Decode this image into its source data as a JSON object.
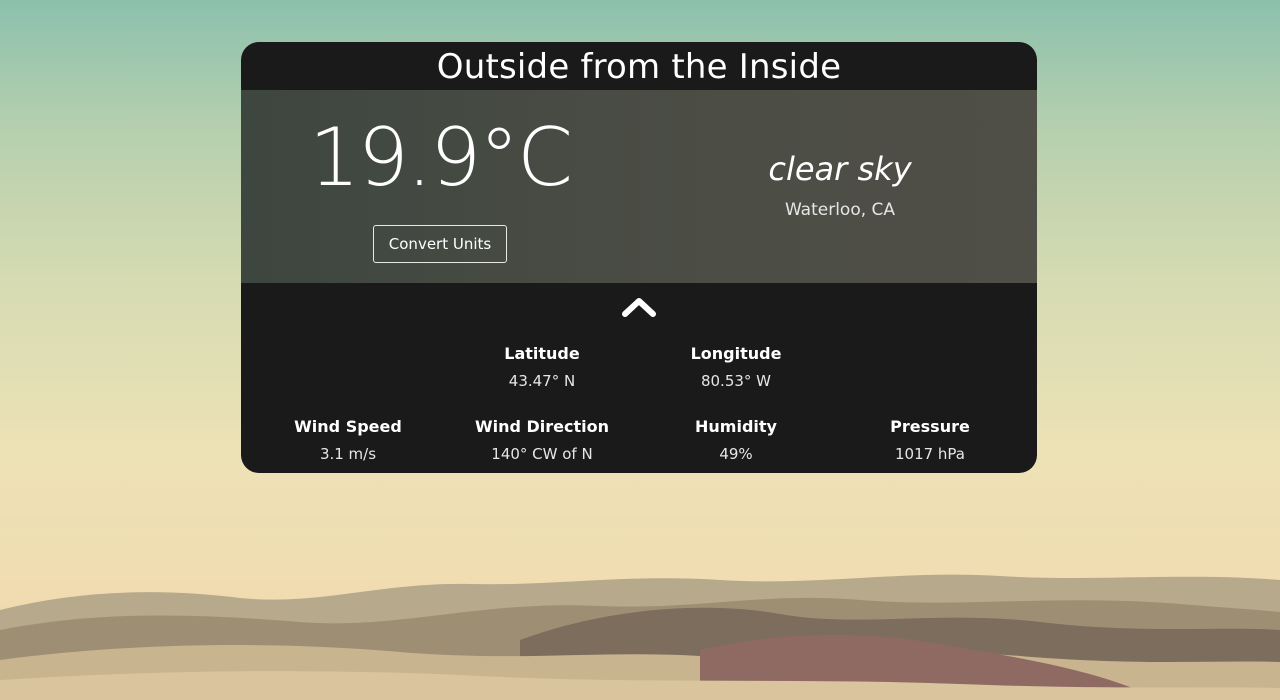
{
  "card": {
    "title": "Outside from the Inside"
  },
  "current": {
    "temperature": "19.9°C",
    "convert_label": "Convert Units",
    "description": "clear sky",
    "location": "Waterloo, CA"
  },
  "toggle": {
    "icon": "chevron-up-icon"
  },
  "details": {
    "latitude": {
      "label": "Latitude",
      "value": "43.47° N"
    },
    "longitude": {
      "label": "Longitude",
      "value": "80.53° W"
    },
    "wind_speed": {
      "label": "Wind Speed",
      "value": "3.1 m/s"
    },
    "wind_direction": {
      "label": "Wind Direction",
      "value": "140° CW of N"
    },
    "humidity": {
      "label": "Humidity",
      "value": "49%"
    },
    "pressure": {
      "label": "Pressure",
      "value": "1017 hPa"
    }
  },
  "colors": {
    "card_background": "#1a1a1a",
    "hero_background": "#4b4d45",
    "text": "#ffffff"
  }
}
